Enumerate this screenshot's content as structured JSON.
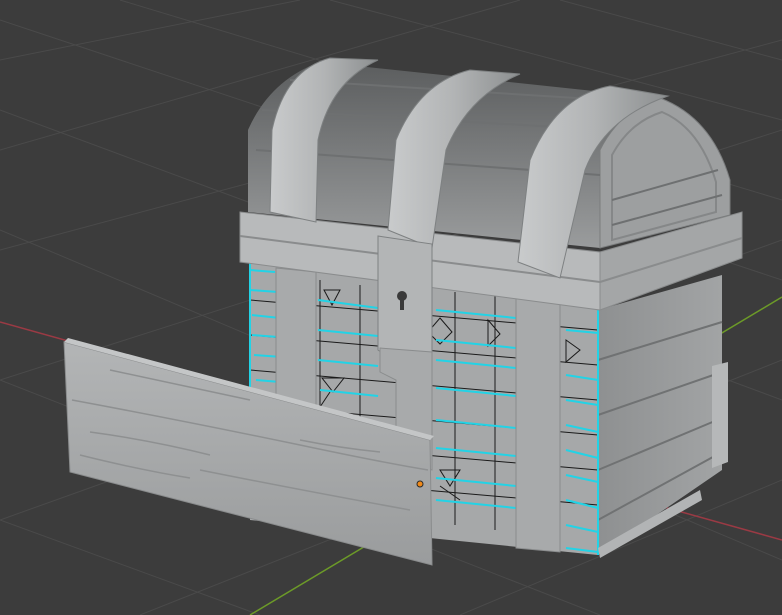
{
  "viewport": {
    "background": "#3c3c3c",
    "grid_color": "#4a4a4a",
    "x_axis_color": "#9a3a44",
    "y_axis_color": "#6c9a28"
  },
  "colors": {
    "metal_band": "#b4b7b8",
    "metal_band_shade": "#8e9192",
    "wood_light": "#a7a9aa",
    "wood_mid": "#8d8f90",
    "wood_dark": "#6e7071",
    "lid_dark": "#5a5c5d",
    "selected_edge": "#22d3e6",
    "wire": "#1a1a1a",
    "origin_point": "#f08a1a"
  },
  "objects": [
    {
      "name": "Chest"
    },
    {
      "name": "Plank"
    }
  ]
}
